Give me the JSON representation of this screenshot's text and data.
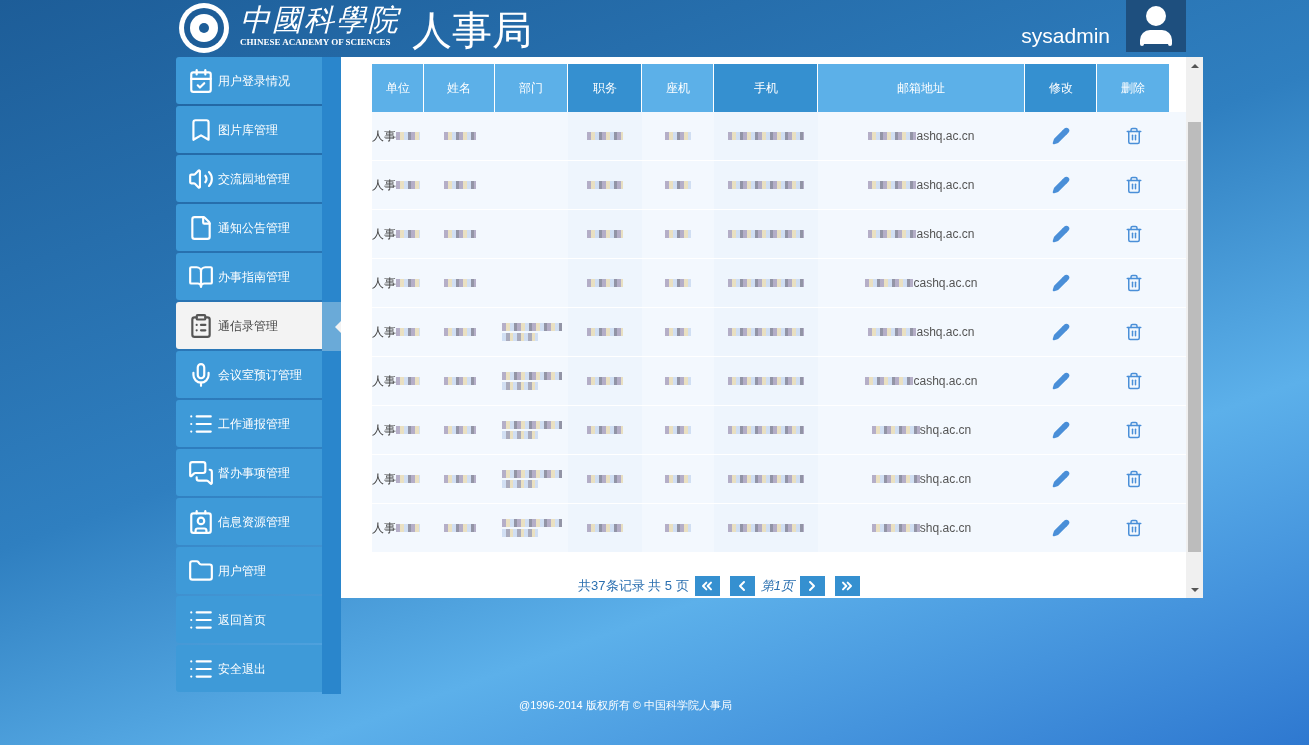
{
  "header": {
    "logo_main": "中國科學院",
    "logo_sub": "CHINESE ACADEMY OF SCIENCES",
    "department": "人事局",
    "username": "sysadmin"
  },
  "sidebar": {
    "items": [
      {
        "label": "用户登录情况",
        "selected": false
      },
      {
        "label": "图片库管理",
        "selected": false
      },
      {
        "label": "交流园地管理",
        "selected": false
      },
      {
        "label": "通知公告管理",
        "selected": false
      },
      {
        "label": "办事指南管理",
        "selected": false
      },
      {
        "label": "通信录管理",
        "selected": true
      },
      {
        "label": "会议室预订管理",
        "selected": false
      },
      {
        "label": "工作通报管理",
        "selected": false
      },
      {
        "label": "督办事项管理",
        "selected": false
      },
      {
        "label": "信息资源管理",
        "selected": false
      },
      {
        "label": "用户管理",
        "selected": false
      },
      {
        "label": "返回首页",
        "selected": false
      },
      {
        "label": "安全退出",
        "selected": false
      }
    ]
  },
  "table": {
    "columns": [
      {
        "label": "单位",
        "dark": false
      },
      {
        "label": "姓名",
        "dark": false
      },
      {
        "label": "部门",
        "dark": false
      },
      {
        "label": "职务",
        "dark": true
      },
      {
        "label": "座机",
        "dark": false
      },
      {
        "label": "手机",
        "dark": true
      },
      {
        "label": "邮箱地址",
        "dark": false
      },
      {
        "label": "修改",
        "dark": true
      },
      {
        "label": "删除",
        "dark": false
      }
    ],
    "rows": [
      {
        "unit": "人事",
        "email": "ashq.ac.cn",
        "dept_blurred": false
      },
      {
        "unit": "人事",
        "email": "ashq.ac.cn",
        "dept_blurred": false
      },
      {
        "unit": "人事",
        "email": "ashq.ac.cn",
        "dept_blurred": false
      },
      {
        "unit": "人事",
        "email": "cashq.ac.cn",
        "dept_blurred": false
      },
      {
        "unit": "人事",
        "email": "ashq.ac.cn",
        "dept_blurred": true
      },
      {
        "unit": "人事",
        "email": "cashq.ac.cn",
        "dept_blurred": true
      },
      {
        "unit": "人事",
        "email": "shq.ac.cn",
        "dept_blurred": true
      },
      {
        "unit": "人事",
        "email": "shq.ac.cn",
        "dept_blurred": true
      },
      {
        "unit": "人事",
        "email": "shq.ac.cn",
        "dept_blurred": true
      }
    ]
  },
  "pagination": {
    "summary": "共37条记录 共 5 页",
    "current": "第1页"
  },
  "footer": "@1996-2014 版权所有 © 中国科学院人事局"
}
